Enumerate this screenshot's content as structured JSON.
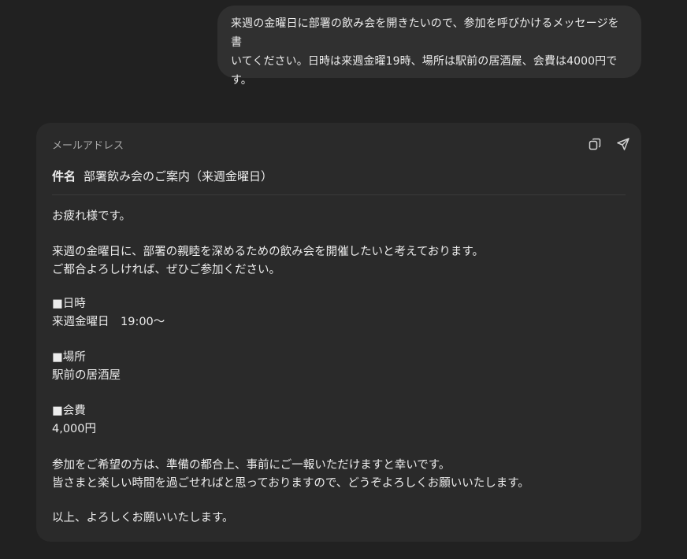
{
  "user_message": {
    "text": "来週の金曜日に部署の飲み会を開きたいので、参加を呼びかけるメッセージを書\nいてください。日時は来週金曜19時、場所は駅前の居酒屋、会費は4000円で\nす。"
  },
  "email_card": {
    "label": "メールアドレス",
    "actions": {
      "copy_icon": "copy-icon",
      "send_icon": "send-icon"
    },
    "subject_key": "件名",
    "subject_value": "部署飲み会のご案内（来週金曜日）",
    "paragraphs": [
      "お疲れ様です。",
      "来週の金曜日に、部署の親睦を深めるための飲み会を開催したいと考えております。\nご都合よろしければ、ぜひご参加ください。",
      "■日時\n来週金曜日　19:00〜",
      "■場所\n駅前の居酒屋",
      "■会費\n4,000円",
      "参加をご希望の方は、準備の都合上、事前にご一報いただけますと幸いです。\n皆さまと楽しい時間を過ごせればと思っておりますので、どうぞよろしくお願いいたします。",
      "以上、よろしくお願いいたします。"
    ]
  },
  "colors": {
    "background": "#212121",
    "user_bubble": "#303030",
    "card": "#2a2a2a",
    "text": "#ececec",
    "muted": "#a8a8a8"
  }
}
